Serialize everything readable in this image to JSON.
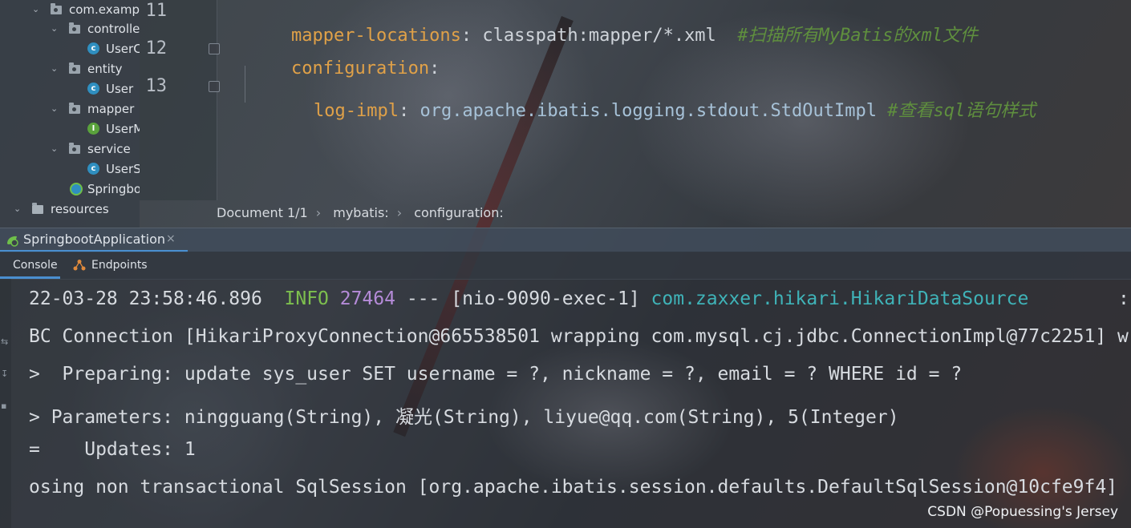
{
  "project_tree": {
    "items": [
      {
        "label": "com.examp",
        "kind": "package",
        "expanded": true
      },
      {
        "label": "controlle",
        "kind": "package",
        "expanded": true
      },
      {
        "label": "UserC",
        "kind": "class"
      },
      {
        "label": "entity",
        "kind": "package",
        "expanded": true
      },
      {
        "label": "User",
        "kind": "class"
      },
      {
        "label": "mapper",
        "kind": "package",
        "expanded": true
      },
      {
        "label": "UserM",
        "kind": "interface"
      },
      {
        "label": "service",
        "kind": "package",
        "expanded": true
      },
      {
        "label": "UserS",
        "kind": "class"
      },
      {
        "label": "Springbo",
        "kind": "spring-class"
      },
      {
        "label": "resources",
        "kind": "resources-folder",
        "expanded": true
      }
    ]
  },
  "editor": {
    "lines": [
      {
        "number": "11",
        "key": "mapper-locations",
        "value": "classpath:mapper/*.xml",
        "comment": "#扫描所有MyBatis的xml文件"
      },
      {
        "number": "12",
        "key": "configuration",
        "value": "",
        "comment": ""
      },
      {
        "number": "13",
        "key": "log-impl",
        "value": "org.apache.ibatis.logging.stdout.StdOutImpl",
        "comment": "#查看sql语句样式"
      }
    ],
    "colors": {
      "key": "#e0a148",
      "value": "#a7c2d8",
      "comment": "#5f8f3e"
    }
  },
  "breadcrumb": {
    "items": [
      "Document 1/1",
      "mybatis:",
      "configuration:"
    ],
    "separator": "›"
  },
  "run": {
    "tab_label": "SpringbootApplication",
    "close_glyph": "×"
  },
  "tool_tabs": [
    {
      "label": "Console",
      "active": true
    },
    {
      "label": "Endpoints",
      "active": false
    }
  ],
  "console": {
    "line1": {
      "timestamp": "22-03-28 23:58:46.896",
      "level": "INFO",
      "pid": "27464",
      "sep": "---",
      "thread": "[nio-9090-exec-1]",
      "logger": "com.zaxxer.hikari.HikariDataSource",
      "tail": ":"
    },
    "lines": [
      "BC Connection [HikariProxyConnection@665538501 wrapping com.mysql.cj.jdbc.ConnectionImpl@77c2251] w",
      ">  Preparing: update sys_user SET username = ?, nickname = ?, email = ? WHERE id = ?",
      "> Parameters: ningguang(String), 凝光(String), liyue@qq.com(String), 5(Integer)",
      "=    Updates: 1",
      "osing non transactional SqlSession [org.apache.ibatis.session.defaults.DefaultSqlSession@10cfe9f4]"
    ],
    "colors": {
      "level": "#7dbf4e",
      "pid": "#b58bd8",
      "logger": "#3fb3b8"
    }
  },
  "watermark": "CSDN @Popuessing's Jersey"
}
